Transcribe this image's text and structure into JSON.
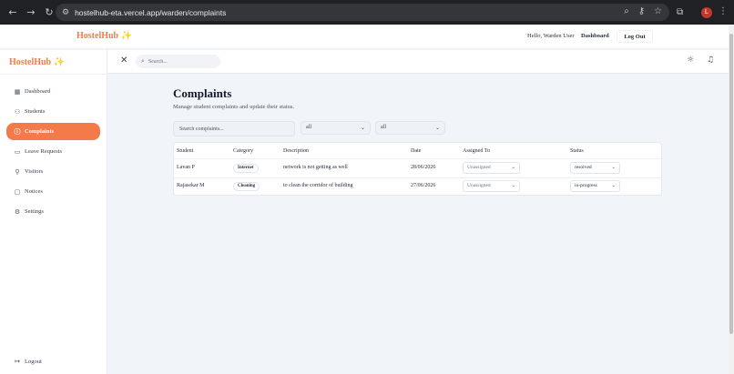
{
  "browser": {
    "url": "hostelhub-eta.vercel.app/warden/complaints",
    "profile_initial": "L"
  },
  "header": {
    "brand": "HostelHub ✨",
    "greeting": "Hello, Warden User",
    "dashboard_link": "Dashboard",
    "logout_button": "Log Out"
  },
  "sidebar": {
    "brand": "HostelHub ✨",
    "items": [
      {
        "label": "Dashboard",
        "icon": "dashboard-icon"
      },
      {
        "label": "Students",
        "icon": "users-icon"
      },
      {
        "label": "Complaints",
        "icon": "alert-circle-icon",
        "active": true
      },
      {
        "label": "Leave Requests",
        "icon": "file-icon"
      },
      {
        "label": "Visitors",
        "icon": "user-plus-icon"
      },
      {
        "label": "Notices",
        "icon": "message-icon"
      },
      {
        "label": "Settings",
        "icon": "gear-icon"
      }
    ],
    "logout": "Logout"
  },
  "appbar": {
    "search_placeholder": "Search..."
  },
  "main": {
    "title": "Complaints",
    "subtitle": "Manage student complaints and update their status.",
    "search_placeholder": "Search complaints...",
    "filter_category": "all",
    "filter_status": "all",
    "table": {
      "headers": [
        "Student",
        "Category",
        "Description",
        "Date",
        "Assigned To",
        "Status"
      ],
      "rows": [
        {
          "student": "Lavan P",
          "category": "Internet",
          "description": "network is not getting as well",
          "date": "28/06/2026",
          "assigned": "Unassigned",
          "status": "resolved"
        },
        {
          "student": "Rajasekar M",
          "category": "Cleaning",
          "description": "to clean the corridor of building",
          "date": "27/06/2026",
          "assigned": "Unassigned",
          "status": "in-progress"
        }
      ]
    }
  },
  "colors": {
    "accent": "#f47a49",
    "brand_text": "#ef7d4f",
    "chrome_bg": "#202124"
  }
}
